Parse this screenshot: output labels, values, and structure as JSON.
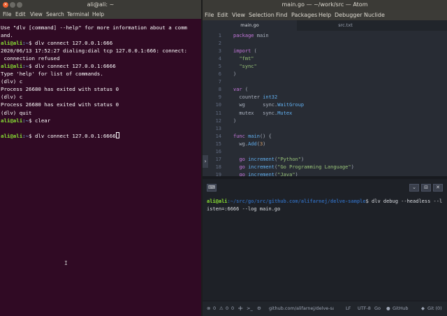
{
  "terminal": {
    "title": "ali@ali: ~",
    "close_glyph": "×",
    "menu": [
      "File",
      "Edit",
      "View",
      "Search",
      "Terminal",
      "Help"
    ],
    "lines": [
      {
        "text": "Use \"dlv [command] --help\" for more information about a comm"
      },
      {
        "text": "and."
      },
      {
        "prompt_user": "ali@ali",
        "prompt_path": ":~",
        "text": "$ dlv connect 127.0.0.1:666"
      },
      {
        "text": "2020/06/13 17:52:27 dialing:dial tcp 127.0.0.1:666: connect:"
      },
      {
        "text": " connection refused"
      },
      {
        "prompt_user": "ali@ali",
        "prompt_path": ":~",
        "text": "$ dlv connect 127.0.0.1:6666"
      },
      {
        "text": "Type 'help' for list of commands."
      },
      {
        "text": "(dlv) c"
      },
      {
        "text": "Process 26680 has exited with status 0"
      },
      {
        "text": "(dlv) c"
      },
      {
        "text": "Process 26680 has exited with status 0"
      },
      {
        "text": "(dlv) quit"
      },
      {
        "prompt_user": "ali@ali",
        "prompt_path": ":~",
        "text": "$ clear"
      },
      {
        "text": ""
      },
      {
        "prompt_user": "ali@ali",
        "prompt_path": ":~",
        "text": "$ dlv connect 127.0.0.1:6666",
        "cursor": true
      }
    ],
    "ibeam": "I"
  },
  "atom": {
    "title": "main.go — ~/work/src — Atom",
    "menu": [
      "File",
      "Edit",
      "View",
      "Selection",
      "Find",
      "Packages",
      "Help",
      "Debugger",
      "Nuclide"
    ],
    "tabs": [
      {
        "label": "main.go",
        "active": true
      },
      {
        "label": "src.txt",
        "active": false
      }
    ],
    "code_lines": [
      {
        "num": "1",
        "tokens": [
          [
            "kw",
            "package"
          ],
          [
            "",
            " main"
          ]
        ]
      },
      {
        "num": "2",
        "tokens": []
      },
      {
        "num": "3",
        "tokens": [
          [
            "kw",
            "import"
          ],
          [
            "",
            " ("
          ]
        ]
      },
      {
        "num": "4",
        "tokens": [
          [
            "",
            "  "
          ],
          [
            "str",
            "\"fmt\""
          ]
        ]
      },
      {
        "num": "5",
        "tokens": [
          [
            "",
            "  "
          ],
          [
            "str",
            "\"sync\""
          ]
        ]
      },
      {
        "num": "6",
        "tokens": [
          [
            "",
            ")"
          ]
        ]
      },
      {
        "num": "7",
        "tokens": []
      },
      {
        "num": "8",
        "tokens": [
          [
            "kw",
            "var"
          ],
          [
            "",
            " ("
          ]
        ]
      },
      {
        "num": "9",
        "tokens": [
          [
            "",
            "  counter "
          ],
          [
            "ty",
            "int32"
          ]
        ]
      },
      {
        "num": "10",
        "tokens": [
          [
            "",
            "  wg      sync."
          ],
          [
            "ty",
            "WaitGroup"
          ]
        ]
      },
      {
        "num": "11",
        "tokens": [
          [
            "",
            "  mutex   sync."
          ],
          [
            "ty",
            "Mutex"
          ]
        ]
      },
      {
        "num": "12",
        "tokens": [
          [
            "",
            ")"
          ]
        ]
      },
      {
        "num": "13",
        "tokens": []
      },
      {
        "num": "14",
        "tokens": [
          [
            "kw",
            "func"
          ],
          [
            "fn",
            " main"
          ],
          [
            "",
            "() {"
          ]
        ]
      },
      {
        "num": "15",
        "tokens": [
          [
            "",
            "  wg."
          ],
          [
            "fn",
            "Add"
          ],
          [
            "",
            "("
          ],
          [
            "num",
            "3"
          ],
          [
            "",
            ")"
          ]
        ]
      },
      {
        "num": "16",
        "tokens": []
      },
      {
        "num": "17",
        "tokens": [
          [
            "",
            "  "
          ],
          [
            "kw",
            "go"
          ],
          [
            "fn",
            " increment"
          ],
          [
            "",
            "("
          ],
          [
            "str",
            "\"Python\""
          ],
          [
            "",
            ")"
          ]
        ]
      },
      {
        "num": "18",
        "tokens": [
          [
            "",
            "  "
          ],
          [
            "kw",
            "go"
          ],
          [
            "fn",
            " increment"
          ],
          [
            "",
            "("
          ],
          [
            "str",
            "\"Go Programming Language\""
          ],
          [
            "",
            ")"
          ]
        ]
      },
      {
        "num": "19",
        "tokens": [
          [
            "",
            "  "
          ],
          [
            "kw",
            "go"
          ],
          [
            "fn",
            " increment"
          ],
          [
            "",
            "("
          ],
          [
            "str",
            "\"Java\""
          ],
          [
            "",
            ")"
          ]
        ]
      }
    ],
    "gutter_toggle": "›",
    "panel": {
      "prompt_user": "ali@ali",
      "prompt_path": ":~/src/go/src/github.com/alifarnej/delve-sample",
      "command": "$ dlv debug --headless --l",
      "continuation": "isten=:6666 --log main.go",
      "buttons": [
        "⌨",
        "⌄",
        "⊟",
        "✕"
      ]
    },
    "status": {
      "errors": "0",
      "warnings": "0",
      "info": "0",
      "add": "+",
      "terminal_icon": ">_",
      "bug_icon": "⚙",
      "path": "github.com/alifarnej/delve-sample",
      "line_ending": "LF",
      "encoding": "UTF-8",
      "grammar": "Go",
      "github": "GitHub",
      "git": "Git (0)"
    }
  }
}
